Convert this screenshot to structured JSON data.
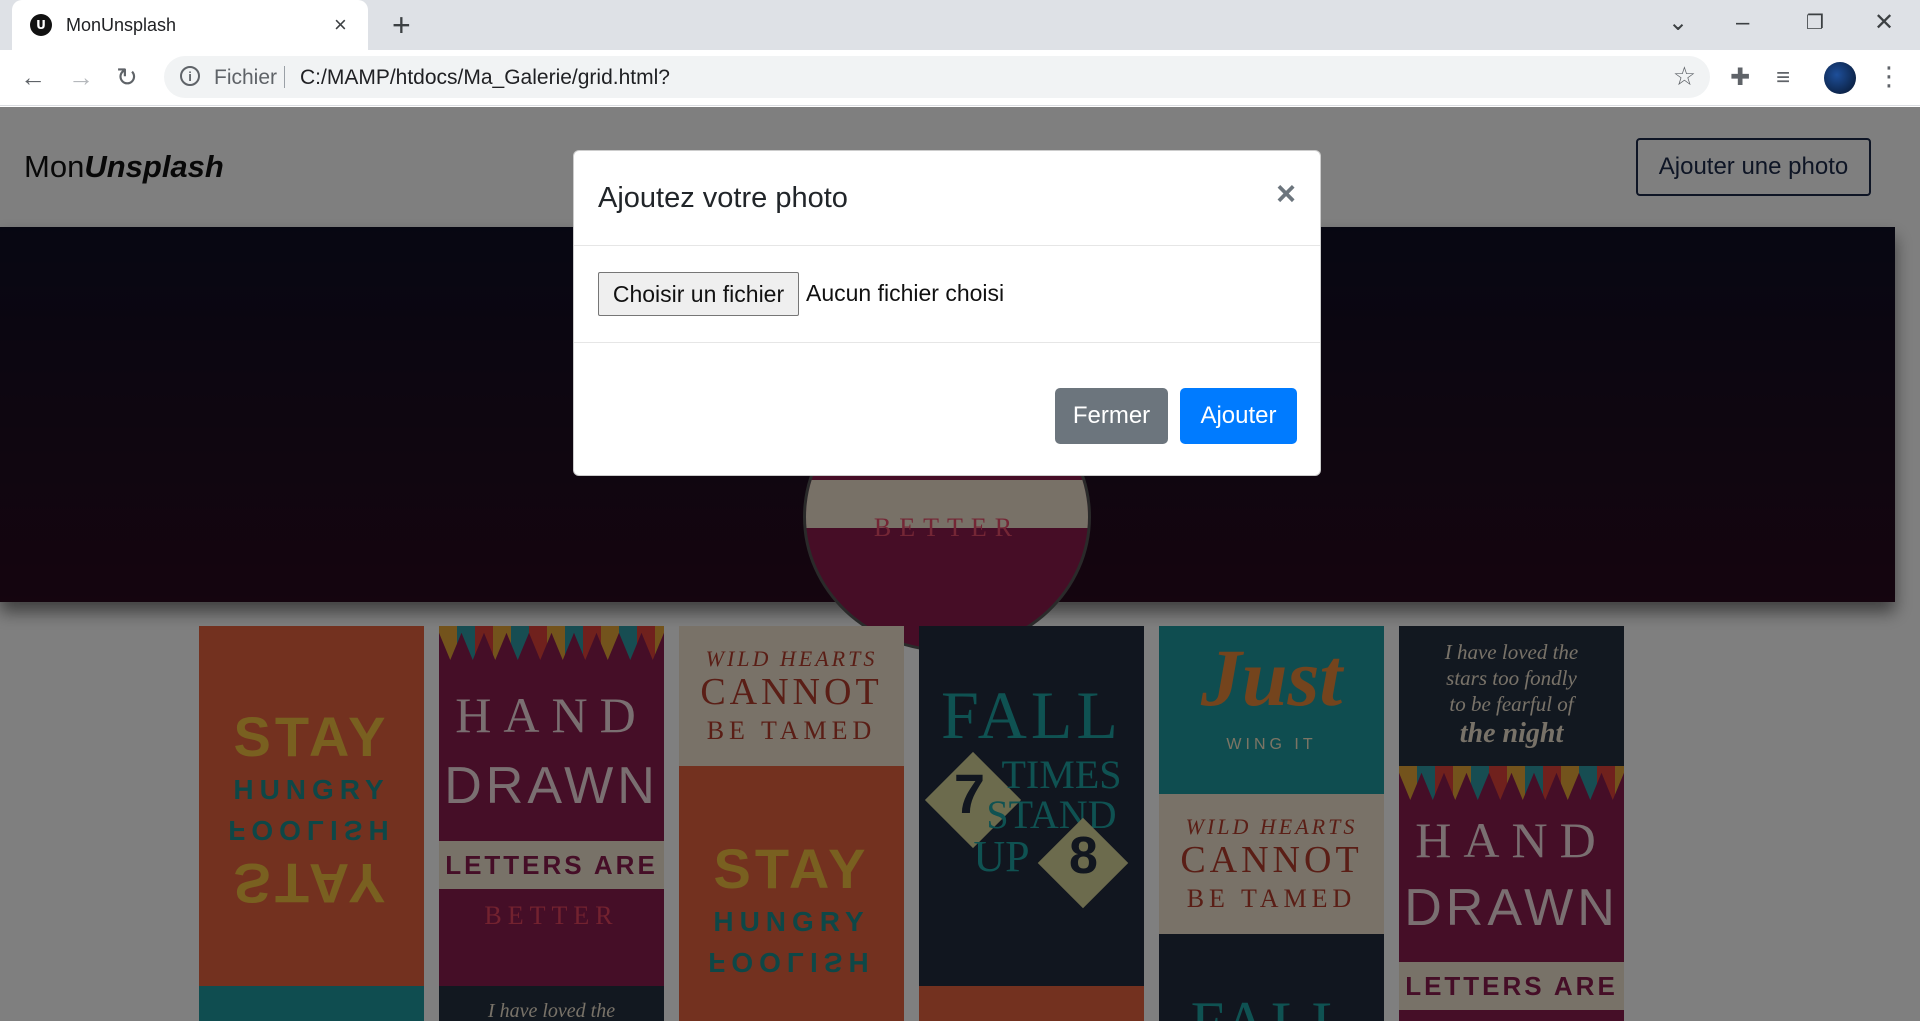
{
  "browser": {
    "tab_title": "MonUnsplash",
    "favicon_letter": "U",
    "omnibox_security_label": "Fichier",
    "url": "C:/MAMP/htdocs/Ma_Galerie/grid.html?"
  },
  "navbar": {
    "brand_prefix": "Mon",
    "brand_suffix": "Unsplash",
    "add_photo_label": "Ajouter une photo"
  },
  "hero": {
    "circle_text": "BETTER"
  },
  "grid": {
    "tiles": [
      {
        "line1": "STAY",
        "line2": "HUNGRY",
        "line3": "FOOLISH",
        "line4": "STAY"
      },
      {
        "line1": "HAND",
        "line2": "DRAWN",
        "line3": "LETTERS ARE",
        "line4": "BETTER",
        "line5": "I have loved the"
      },
      {
        "line1": "WILD HEARTS",
        "line2": "CANNOT",
        "line3": "BE TAMED",
        "line4": "STAY",
        "line5": "HUNGRY",
        "line6": "FOOLISH"
      },
      {
        "line1": "FALL",
        "line2": "7",
        "line3": "TIMES",
        "line4": "STAND",
        "line5": "UP",
        "line6": "8"
      },
      {
        "line1": "Just",
        "line2": "WING IT",
        "line3": "WILD HEARTS",
        "line4": "CANNOT",
        "line5": "BE TAMED",
        "line6": "FALL"
      },
      {
        "line1": "I have loved the",
        "line2": "stars too fondly",
        "line3": "to be fearful of",
        "line4": "the night",
        "line5": "HAND",
        "line6": "DRAWN",
        "line7": "LETTERS ARE"
      }
    ]
  },
  "modal": {
    "title": "Ajoutez votre photo",
    "file_button_label": "Choisir un fichier",
    "file_status": "Aucun fichier choisi",
    "close_label": "Fermer",
    "submit_label": "Ajouter"
  },
  "icons": {
    "tab_close": "×",
    "new_tab": "+",
    "modal_close": "×"
  }
}
